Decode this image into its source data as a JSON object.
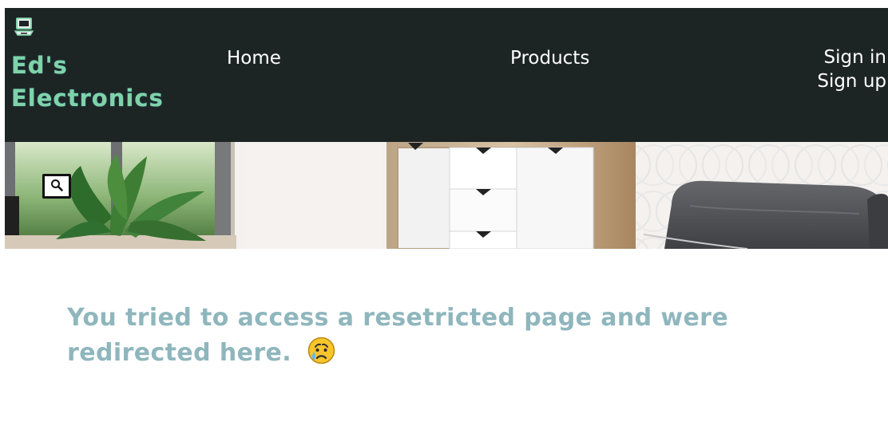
{
  "header": {
    "brand": "Ed's\nElectronics",
    "logo_icon": "laptop-icon",
    "background_color": "#1d2524",
    "brand_color": "#7fd3a7"
  },
  "nav": {
    "home": "Home",
    "products": "Products"
  },
  "auth": {
    "sign_in": "Sign in",
    "sign_up": "Sign up"
  },
  "hero": {
    "image": "living-room-furniture-banner",
    "search_icon": "magnifying-glass-icon"
  },
  "main": {
    "message": "You tried to access a resetricted page and were redirected here.",
    "emoji": "sad-tear-face-emoji",
    "message_color": "#8fb6bd"
  }
}
